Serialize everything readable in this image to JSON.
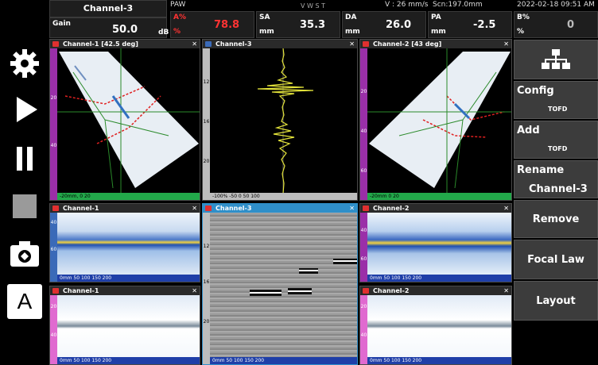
{
  "header": {
    "channel": "Channel-3",
    "mode": "PAW",
    "vwst": "V W S T",
    "velocity": "V : 26 mm/s",
    "scan": "Scn:197.0mm",
    "datetime": "2022-02-18 09:51 AM",
    "gain": {
      "label": "Gain",
      "value": "50.0",
      "unit": "dB"
    },
    "a_pct": {
      "label_top": "A%",
      "label_bottom": "%",
      "value": "78.8",
      "color": "#ff3333"
    },
    "sa": {
      "label": "SA",
      "unit": "mm",
      "value": "35.3"
    },
    "da": {
      "label": "DA",
      "unit": "mm",
      "value": "26.0"
    },
    "pa": {
      "label": "PA",
      "unit": "mm",
      "value": "-2.5"
    },
    "b_pct": {
      "label_top": "B%",
      "label_bottom": "%",
      "value": "0"
    }
  },
  "toolbar": {
    "icons": [
      "gear-icon",
      "play-icon",
      "pause-icon",
      "stop-icon",
      "camera-icon",
      "a-icon"
    ],
    "a_label": "A"
  },
  "menu": {
    "config": {
      "label": "Config",
      "sub": "TOFD"
    },
    "add": {
      "label": "Add",
      "sub": "TOFD"
    },
    "rename": {
      "label": "Rename",
      "sub": "Channel-3"
    },
    "remove": "Remove",
    "focal_law": "Focal Law",
    "layout": "Layout"
  },
  "views": {
    "s1": {
      "title": "Channel-1 [42.5 deg]",
      "bottom": "-20mm, 0 20",
      "left": [
        "20",
        "40"
      ]
    },
    "a3": {
      "title": "Channel-3",
      "bottom": "-100%  -50  0  50  100",
      "left": [
        "12",
        "16",
        "20"
      ]
    },
    "s2": {
      "title": "Channel-2 [43 deg]",
      "bottom": "-20mm  0  20",
      "left": [
        "20",
        "40",
        "60"
      ]
    },
    "c1": {
      "title": "Channel-1",
      "bottom": "0mm   50   100   150   200",
      "left": [
        "40",
        "60"
      ]
    },
    "b3": {
      "title": "Channel-3",
      "bottom": "0mm   50   100   150   200",
      "left": [
        "12",
        "16",
        "20"
      ]
    },
    "c2": {
      "title": "Channel-2",
      "bottom": "0mm   50   100   150   200",
      "left": [
        "40",
        "60"
      ]
    },
    "d1": {
      "title": "Channel-1",
      "bottom": "0mm   50   100   150   200",
      "left": [
        "20",
        "40"
      ]
    },
    "d2": {
      "title": "Channel-2",
      "bottom": "0mm   50   100   150   200",
      "left": [
        "20",
        "40"
      ]
    }
  },
  "colors": {
    "active": "#2f8fc9",
    "signal": "#e3e33a",
    "scale_purple": "#9a2fa8",
    "scale_green": "#22a84a"
  }
}
